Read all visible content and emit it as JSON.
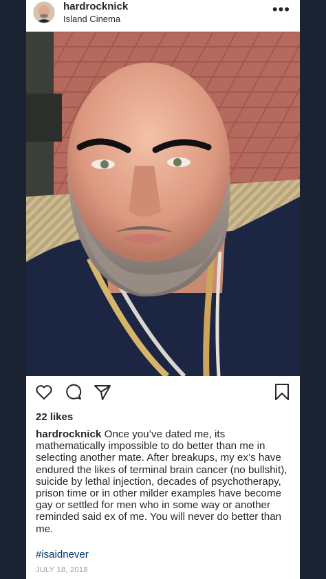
{
  "post": {
    "username": "hardrocknick",
    "location": "Island Cinema",
    "more_icon": "more-horizontal-icon",
    "likes": "22 likes",
    "caption_username": "hardrocknick",
    "caption_text": "Once you’ve dated me, its mathematically impossible to do better than me in selecting another mate.  After breakups, my ex’s have endured the likes of terminal brain cancer (no bullshit), suicide by lethal injection, decades of psychotherapy, prison time or in other milder examples have become gay or settled for men who in some way or another reminded said ex of me.  You will never do better than me.",
    "hashtag": "#isaidnever",
    "date": "JULY 18, 2018"
  },
  "icons": [
    "heart-icon",
    "comment-icon",
    "share-icon",
    "bookmark-icon"
  ],
  "colors": {
    "background": "#1b2232",
    "card": "#ffffff",
    "text": "#262626",
    "hashtag": "#003569",
    "muted": "#999999"
  }
}
